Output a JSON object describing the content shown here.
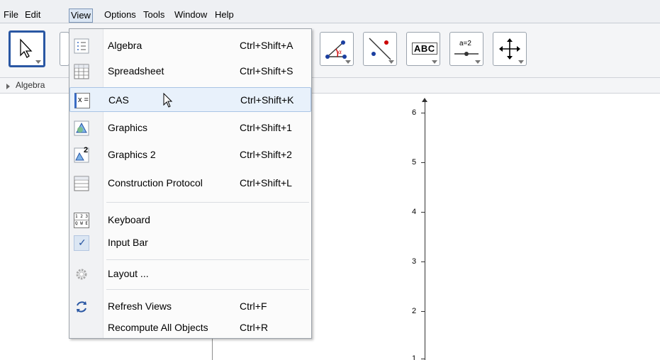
{
  "menubar": {
    "items": [
      {
        "label": "File"
      },
      {
        "label": "Edit"
      },
      {
        "label": "View"
      },
      {
        "label": "Options"
      },
      {
        "label": "Tools"
      },
      {
        "label": "Window"
      },
      {
        "label": "Help"
      }
    ]
  },
  "toolbar": {
    "text_tool_label": "ABC",
    "slider_tool_label": "a=2"
  },
  "subbar": {
    "algebra_label": "Algebra"
  },
  "graphics": {
    "y_ticks": [
      "6",
      "5",
      "4",
      "3",
      "2",
      "1"
    ]
  },
  "view_menu": {
    "items": [
      {
        "label": "Algebra",
        "shortcut": "Ctrl+Shift+A",
        "icon": "algebra-view-icon"
      },
      {
        "label": "Spreadsheet",
        "shortcut": "Ctrl+Shift+S",
        "icon": "spreadsheet-icon"
      },
      {
        "label": "CAS",
        "shortcut": "Ctrl+Shift+K",
        "icon": "cas-icon",
        "icon_text": "x ="
      },
      {
        "label": "Graphics",
        "shortcut": "Ctrl+Shift+1",
        "icon": "graphics-icon"
      },
      {
        "label": "Graphics 2",
        "shortcut": "Ctrl+Shift+2",
        "icon": "graphics2-icon",
        "icon_text": "2"
      },
      {
        "label": "Construction Protocol",
        "shortcut": "Ctrl+Shift+L",
        "icon": "construction-protocol-icon"
      },
      {
        "label": "Keyboard",
        "shortcut": "",
        "icon": "keyboard-icon",
        "icon_text_top": "1 2 3",
        "icon_text_bottom": "Q W E"
      },
      {
        "label": "Input Bar",
        "shortcut": "",
        "icon": "checkmark-icon",
        "icon_text": "✓"
      },
      {
        "label": "Layout ...",
        "shortcut": "",
        "icon": "gear-icon"
      },
      {
        "label": "Refresh Views",
        "shortcut": "Ctrl+F",
        "icon": "refresh-icon"
      },
      {
        "label": "Recompute All Objects",
        "shortcut": "Ctrl+R",
        "icon": ""
      }
    ]
  },
  "colors": {
    "accent": "#2a57a3",
    "hover_bg": "#e8f1fb"
  }
}
